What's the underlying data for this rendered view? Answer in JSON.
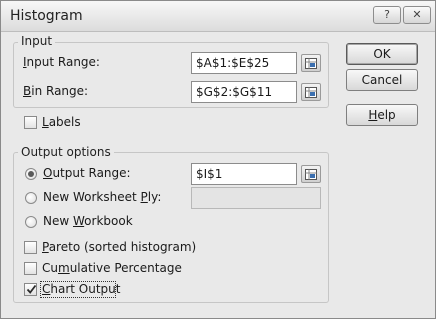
{
  "window": {
    "title": "Histogram",
    "help_glyph": "?",
    "close_glyph": "✕"
  },
  "input_group": {
    "label": "Input",
    "input_range_label": "Input Range:",
    "input_range_value": "$A$1:$E$25",
    "bin_range_label": "Bin Range:",
    "bin_range_value": "$G$2:$G$11"
  },
  "labels_checkbox": {
    "label": "Labels",
    "checked": false
  },
  "output_group": {
    "label": "Output options",
    "output_range_label": "Output Range:",
    "output_range_value": "$I$1",
    "new_worksheet_label": "New Worksheet Ply:",
    "new_worksheet_value": "",
    "new_workbook_label": "New Workbook",
    "selected": "output_range"
  },
  "options": {
    "pareto_label": "Pareto (sorted histogram)",
    "pareto_checked": false,
    "cumulative_label": "Cumulative Percentage",
    "cumulative_checked": false,
    "chart_label": "Chart Output",
    "chart_checked": true
  },
  "buttons": {
    "ok": "OK",
    "cancel": "Cancel",
    "help": "Help"
  },
  "icons": {
    "titlebar_help": "help-icon",
    "titlebar_close": "close-icon",
    "range_picker": "range-picker-icon",
    "checkmark": "checkmark-icon"
  }
}
